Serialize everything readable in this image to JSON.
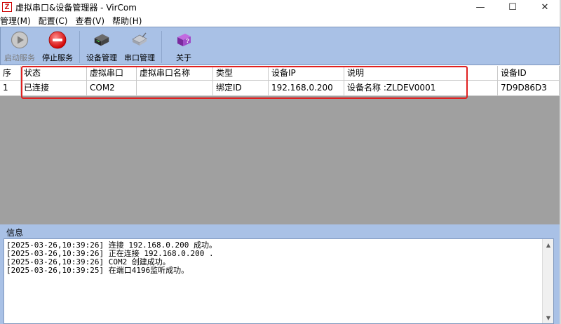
{
  "window": {
    "app_icon_glyph": "Z",
    "title": "虚拟串口&设备管理器 - VirCom",
    "minimize_glyph": "—",
    "maximize_glyph": "☐",
    "close_glyph": "✕"
  },
  "menu": [
    {
      "label": "管理(M)"
    },
    {
      "label": "配置(C)"
    },
    {
      "label": "查看(V)"
    },
    {
      "label": "帮助(H)"
    }
  ],
  "toolbar": {
    "start_service": "启动服务",
    "stop_service": "停止服务",
    "device_mgmt": "设备管理",
    "port_mgmt": "串口管理",
    "about": "关于"
  },
  "table": {
    "columns": [
      "序",
      "状态",
      "虚拟串口",
      "虚拟串口名称",
      "类型",
      "设备IP",
      "说明",
      "设备ID"
    ],
    "rows": [
      [
        "1",
        "已连接",
        "COM2",
        "",
        "绑定ID",
        "192.168.0.200",
        "设备名称 :ZLDEV0001",
        "7D9D86D3"
      ]
    ]
  },
  "info": {
    "title": "信息",
    "log": [
      "[2025-03-26,10:39:26] 连接 192.168.0.200 成功。",
      "[2025-03-26,10:39:26] 正在连接 192.168.0.200 .",
      "[2025-03-26,10:39:26] COM2 创建成功。",
      "[2025-03-26,10:39:25] 在端口4196监听成功。"
    ]
  },
  "colors": {
    "toolbar_bg": "#a9c1e6",
    "grid_empty_bg": "#a0a0a0",
    "highlight_box": "#e02020"
  },
  "icons": {
    "start": "play-circle-icon",
    "stop": "red-stop-circle-icon",
    "device": "device-box-icon",
    "port": "serial-port-icon",
    "about": "help-book-icon"
  }
}
